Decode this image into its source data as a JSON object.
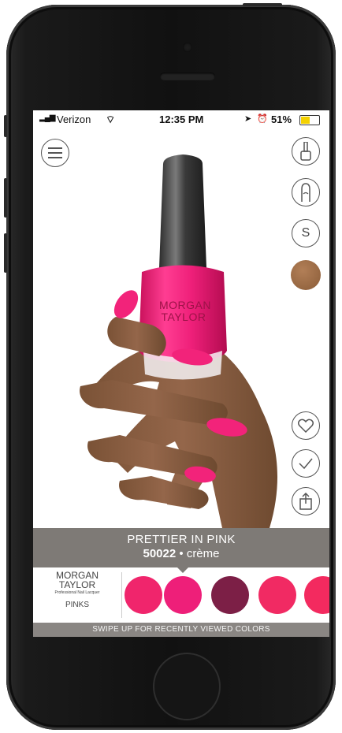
{
  "status_bar": {
    "carrier": "Verizon",
    "time": "12:35 PM",
    "battery": "51%"
  },
  "bottle": {
    "brand_line1": "MORGAN",
    "brand_line2": "TAYLOR"
  },
  "shade": {
    "name": "PRETTIER IN PINK",
    "code": "50022",
    "separator": "•",
    "finish": "crème"
  },
  "carousel": {
    "brand_line1": "MORGAN",
    "brand_line2": "TAYLOR",
    "tagline": "Professional Nail Lacquer",
    "collection": "PINKS",
    "swatches": [
      {
        "color": "#f0256c"
      },
      {
        "color": "#ee1f79"
      },
      {
        "color": "#7c1f46"
      },
      {
        "color": "#f12a63"
      },
      {
        "color": "#f32a5f"
      }
    ]
  },
  "hint": {
    "swipe_text": "SWIPE UP FOR RECENTLY VIEWED COLORS"
  },
  "colors": {
    "polish": "#f2237a",
    "skin_swatch": "#9a6a44",
    "bar_bg": "#5a5550"
  },
  "icons": {
    "menu": "hamburger-menu-icon",
    "polish_tool": "nail-polish-bottle-icon",
    "nail_shape": "nail-shape-icon",
    "size": "size-s-icon",
    "skin_tone": "skin-tone-swatch",
    "favorite": "heart-icon",
    "confirm": "checkmark-icon",
    "share": "share-icon"
  },
  "size_label": "S"
}
